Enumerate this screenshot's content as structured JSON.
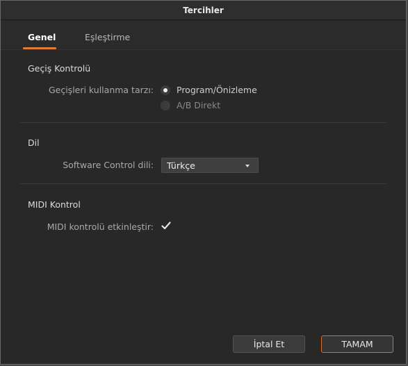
{
  "window": {
    "title": "Tercihler"
  },
  "tabs": [
    {
      "label": "Genel",
      "active": true
    },
    {
      "label": "Eşleştirme",
      "active": false
    }
  ],
  "transition": {
    "section_title": "Geçiş Kontrolü",
    "label": "Geçişleri kullanma tarzı:",
    "options": [
      {
        "label": "Program/Önizleme",
        "selected": true
      },
      {
        "label": "A/B Direkt",
        "selected": false
      }
    ]
  },
  "language": {
    "section_title": "Dil",
    "label": "Software Control dili:",
    "selected_value": "Türkçe"
  },
  "midi": {
    "section_title": "MIDI Kontrol",
    "label": "MIDI kontrolü etkinleştir:",
    "enabled": true
  },
  "buttons": {
    "cancel_label": "İptal Et",
    "ok_label": "TAMAM"
  },
  "colors": {
    "accent": "#e07a34",
    "background": "#282828"
  }
}
